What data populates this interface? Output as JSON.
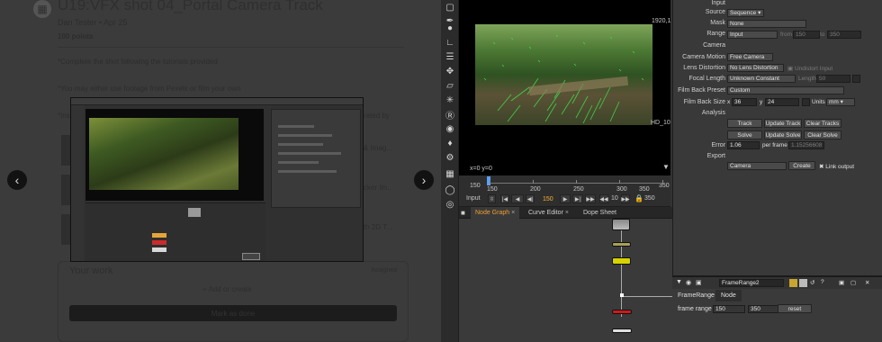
{
  "classroom": {
    "title": "U19:VFX shot 04_Portal Camera Track",
    "subtitle": "Dan Tester • Apr 25",
    "points": "100 points",
    "instructions1": "*Complete the shot following the tutorials provided",
    "instructions2": "*You may either use footage from Pexels or film your own",
    "instructions3": "*Ins",
    "right_fragment1": "rated by",
    "right_fragment2": "& Imag...",
    "right_fragment3": "cker Im...",
    "right_fragment4": "th 2D T...",
    "your_work": "Your work",
    "assigned": "Assigned",
    "add_create": "Add or create",
    "mark_done": "Mark as done",
    "prev_icon": "chevron-left-icon",
    "next_icon": "chevron-right-icon"
  },
  "nuke": {
    "viewer": {
      "resolution": "1920,1",
      "format_label": "HD_10",
      "coords": "x=0 y=0",
      "frame_start": "150",
      "frame_end": "350",
      "timeline_ticks": [
        "150",
        "200",
        "250",
        "300",
        "350"
      ],
      "input_label": "Input",
      "current_frame": "150",
      "step_value": "10",
      "end_field": "350"
    },
    "tabs": [
      "Node Graph",
      "Curve Editor",
      "Dope Sheet"
    ],
    "properties": {
      "input_header": "Input",
      "source_label": "Source",
      "source_value": "Sequence",
      "mask_label": "Mask",
      "mask_value": "None",
      "range_label": "Range",
      "range_value": "Input",
      "from_label": "from",
      "from_value": "150",
      "to_label": "to",
      "to_value": "350",
      "camera_header": "Camera",
      "camera_motion_label": "Camera Motion",
      "camera_motion_value": "Free Camera",
      "lens_distortion_label": "Lens Distortion",
      "lens_distortion_value": "No Lens Distortion",
      "undistort_input": "Undistort Input",
      "focal_length_label": "Focal Length",
      "focal_length_value": "Unknown Constant",
      "length_label": "Length",
      "length_value": "50",
      "film_back_preset_label": "Film Back Preset",
      "film_back_preset_value": "Custom",
      "film_back_size_label": "Film Back Size",
      "film_x_label": "x",
      "film_x_value": "36",
      "film_y_label": "y",
      "film_y_value": "24",
      "units_label": "Units",
      "units_value": "mm",
      "analysis_header": "Analysis",
      "track_button": "Track",
      "update_track_button": "Update Track",
      "clear_tracks_button": "Clear Tracks",
      "solve_button": "Solve",
      "update_solve_button": "Update Solve",
      "clear_solve_button": "Clear Solve",
      "error_label": "Error",
      "error_value": "1.06",
      "per_frame_label": "per frame",
      "per_frame_value": "1.15256608",
      "export_header": "Export",
      "export_value": "Camera",
      "create_button": "Create",
      "link_output": "Link output"
    },
    "frame_range_panel": {
      "node_name": "FrameRange2",
      "tab1": "FrameRange",
      "tab2": "Node",
      "frame_range_label": "frame range",
      "first_value": "150",
      "last_value": "350",
      "reset_button": "reset"
    }
  }
}
